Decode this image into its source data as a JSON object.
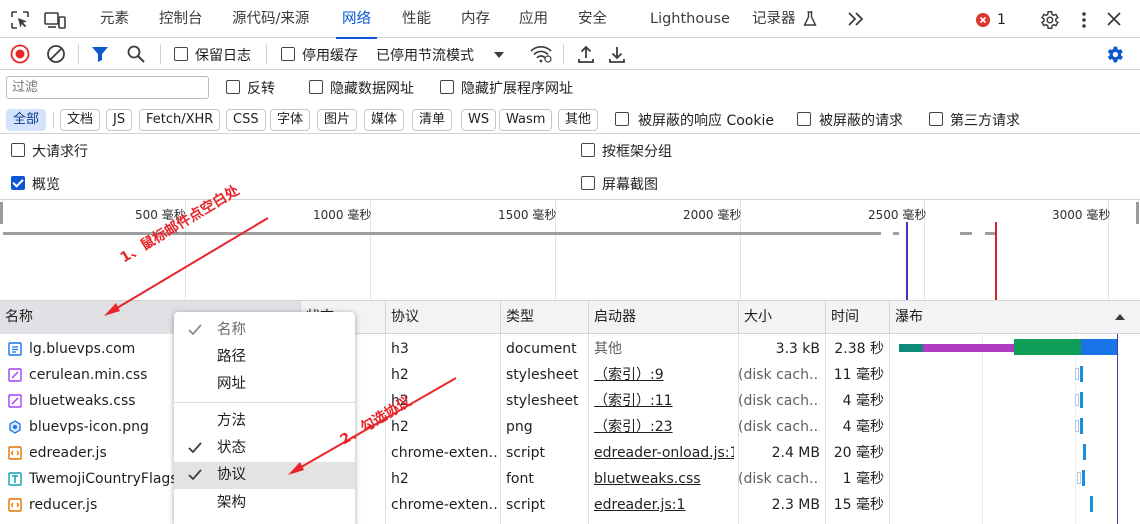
{
  "tabs": [
    {
      "label": "元素",
      "active": false
    },
    {
      "label": "控制台",
      "active": false
    },
    {
      "label": "源代码/来源",
      "active": false
    },
    {
      "label": "网络",
      "active": true
    },
    {
      "label": "性能",
      "active": false
    },
    {
      "label": "内存",
      "active": false
    },
    {
      "label": "应用",
      "active": false
    },
    {
      "label": "安全",
      "active": false
    },
    {
      "label": "Lighthouse",
      "active": false
    },
    {
      "label": "记录器",
      "active": false
    }
  ],
  "error_count": "1",
  "toolbar": {
    "preserve_log": "保留日志",
    "disable_cache": "停用缓存",
    "throttling": "已停用节流模式"
  },
  "filter": {
    "placeholder": "过滤",
    "invert": "反转",
    "hide_data_urls": "隐藏数据网址",
    "hide_extension_urls": "隐藏扩展程序网址"
  },
  "types": [
    "全部",
    "文档",
    "JS",
    "Fetch/XHR",
    "CSS",
    "字体",
    "图片",
    "媒体",
    "清单",
    "WS",
    "Wasm",
    "其他"
  ],
  "blocked_cookies": "被屏蔽的响应 Cookie",
  "blocked_requests": "被屏蔽的请求",
  "third_party": "第三方请求",
  "options": {
    "big_rows": "大请求行",
    "group_by_frame": "按框架分组",
    "overview": "概览",
    "screenshots": "屏幕截图"
  },
  "timeline_labels": [
    "500 毫秒",
    "1000 毫秒",
    "1500 毫秒",
    "2000 毫秒",
    "2500 毫秒",
    "3000 毫秒"
  ],
  "columns": {
    "name": "名称",
    "status": "状态",
    "protocol": "协议",
    "type": "类型",
    "initiator": "启动器",
    "size": "大小",
    "time": "时间",
    "waterfall": "瀑布"
  },
  "rows": [
    {
      "name": "lg.bluevps.com",
      "icon": "document-icon",
      "protocol": "h3",
      "type": "document",
      "initiator": "其他",
      "initiator_link": false,
      "size": "3.3 kB",
      "time": "2.38 秒"
    },
    {
      "name": "cerulean.min.css",
      "icon": "stylesheet-icon",
      "protocol": "h2",
      "type": "stylesheet",
      "initiator": "（索引）:9",
      "initiator_link": true,
      "size": "(disk cach…",
      "time": "11 毫秒"
    },
    {
      "name": "bluetweaks.css",
      "icon": "stylesheet-icon",
      "protocol": "h2",
      "type": "stylesheet",
      "initiator": "（索引）:11",
      "initiator_link": true,
      "size": "(disk cach…",
      "time": "4 毫秒"
    },
    {
      "name": "bluevps-icon.png",
      "icon": "image-icon",
      "protocol": "h2",
      "type": "png",
      "initiator": "（索引）:23",
      "initiator_link": true,
      "size": "(disk cach…",
      "time": "4 毫秒"
    },
    {
      "name": "edreader.js",
      "icon": "script-icon",
      "protocol": "chrome-exten…",
      "type": "script",
      "initiator": "edreader-onload.js:1",
      "initiator_link": true,
      "size": "2.4 MB",
      "time": "20 毫秒"
    },
    {
      "name": "TwemojiCountryFlags.",
      "icon": "font-icon",
      "protocol": "h2",
      "type": "font",
      "initiator": "bluetweaks.css",
      "initiator_link": true,
      "size": "(disk cach…",
      "time": "1 毫秒"
    },
    {
      "name": "reducer.js",
      "icon": "script-icon",
      "protocol": "chrome-exten…",
      "type": "script",
      "initiator": "edreader.js:1",
      "initiator_link": true,
      "size": "2.3 MB",
      "time": "15 毫秒"
    }
  ],
  "context_menu": [
    {
      "label": "名称",
      "checked": true,
      "dim": true
    },
    {
      "label": "路径",
      "checked": false,
      "dim": false
    },
    {
      "label": "网址",
      "checked": false,
      "dim": false
    },
    {
      "label": "方法",
      "checked": false,
      "dim": false
    },
    {
      "label": "状态",
      "checked": true,
      "dim": false
    },
    {
      "label": "协议",
      "checked": true,
      "dim": false,
      "hover": true
    },
    {
      "label": "架构",
      "checked": false,
      "dim": false
    }
  ],
  "annotations": {
    "step1": "1、鼠标邮件点空白处",
    "step2": "2、勾选协议"
  },
  "colors": {
    "accent": "#0b57d0",
    "record": "#e8262a",
    "annotation": "#e8262a"
  }
}
